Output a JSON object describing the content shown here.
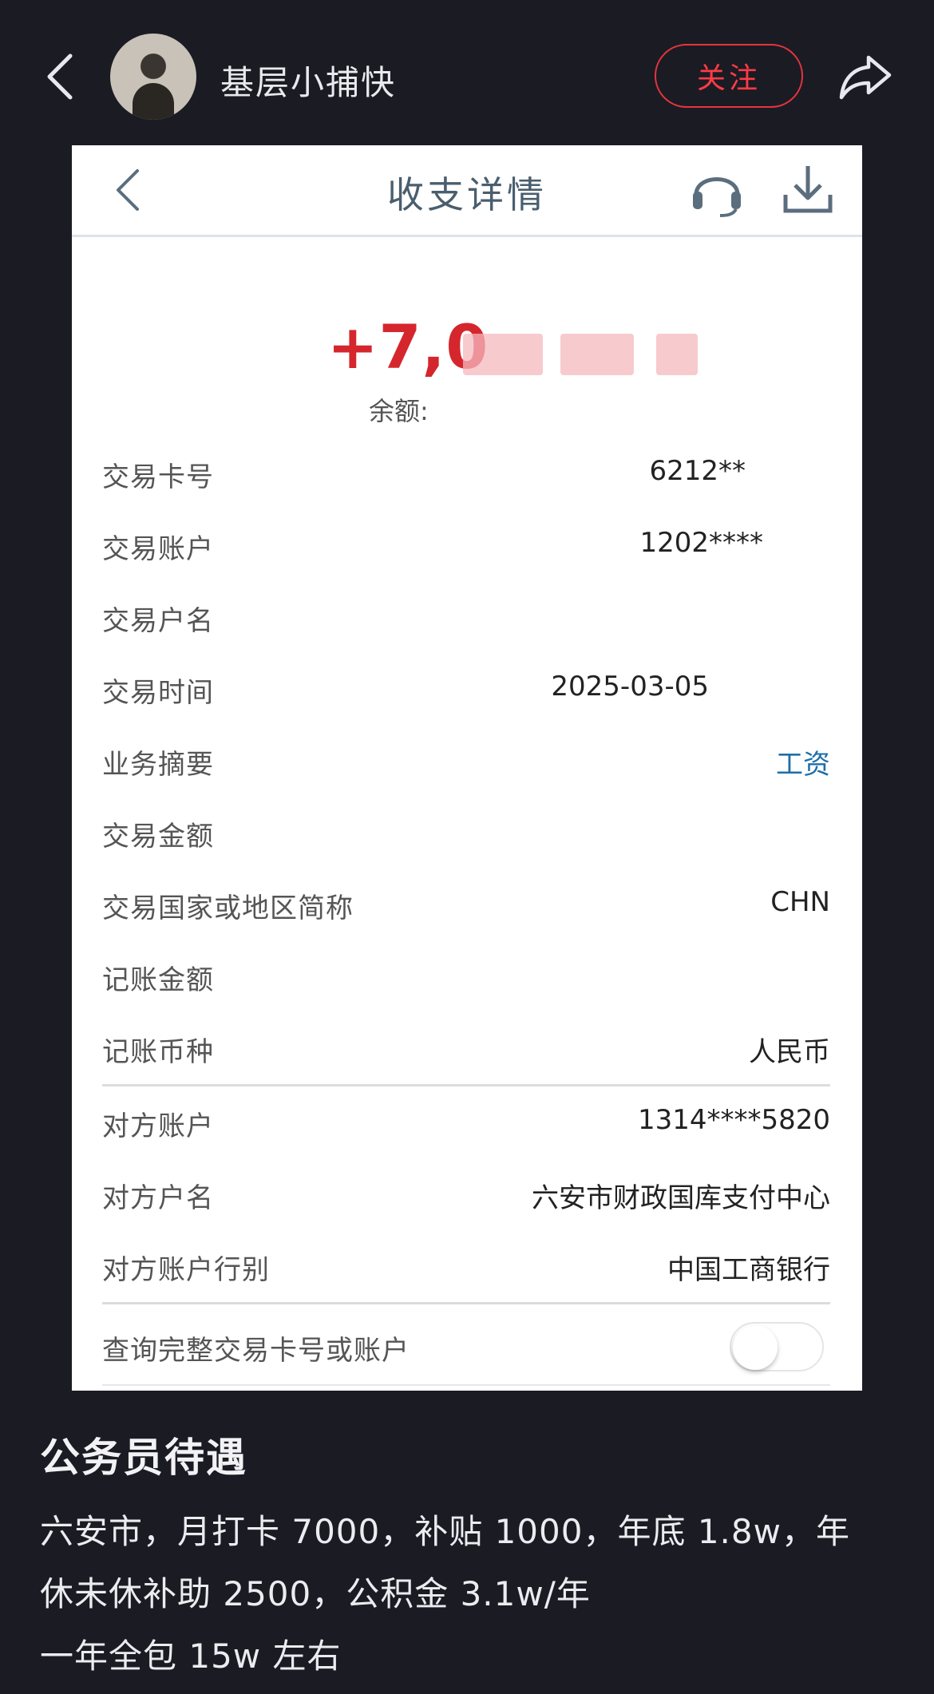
{
  "author": {
    "username": "基层小捕快",
    "follow_label": "关注"
  },
  "card": {
    "title": "收支详情",
    "amount": "+7,0",
    "amount_color": "#d5262d",
    "balance_label": "余额:",
    "rows": [
      {
        "label": "交易卡号",
        "value": "6212**"
      },
      {
        "label": "交易账户",
        "value": "1202****"
      },
      {
        "label": "交易户名",
        "value": ""
      },
      {
        "label": "交易时间",
        "value": "2025-03-05"
      },
      {
        "label": "业务摘要",
        "value": "工资"
      },
      {
        "label": "交易金额",
        "value": ""
      },
      {
        "label": "交易国家或地区简称",
        "value": "CHN"
      },
      {
        "label": "记账金额",
        "value": ""
      },
      {
        "label": "记账币种",
        "value": "人民币"
      }
    ],
    "counterparty_rows": [
      {
        "label": "对方账户",
        "value": "1314****5820"
      },
      {
        "label": "对方户名",
        "value": "六安市财政国库支付中心"
      },
      {
        "label": "对方账户行别",
        "value": "中国工商银行"
      }
    ],
    "toggle_label": "查询完整交易卡号或账户",
    "toggle_on": false
  },
  "post": {
    "title": "公务员待遇",
    "lines": [
      "六安市，月打卡 7000，补贴 1000，年底 1.8w，年",
      "休未休补助 2500，公积金 3.1w/年",
      "一年全包 15w 左右"
    ]
  },
  "colors": {
    "background": "#1b1b23",
    "follow_red": "#e6343f",
    "link_blue": "#1d6fa8"
  },
  "icons": [
    "chevron-left-icon",
    "share-arrow-icon",
    "headset-icon",
    "download-icon"
  ]
}
